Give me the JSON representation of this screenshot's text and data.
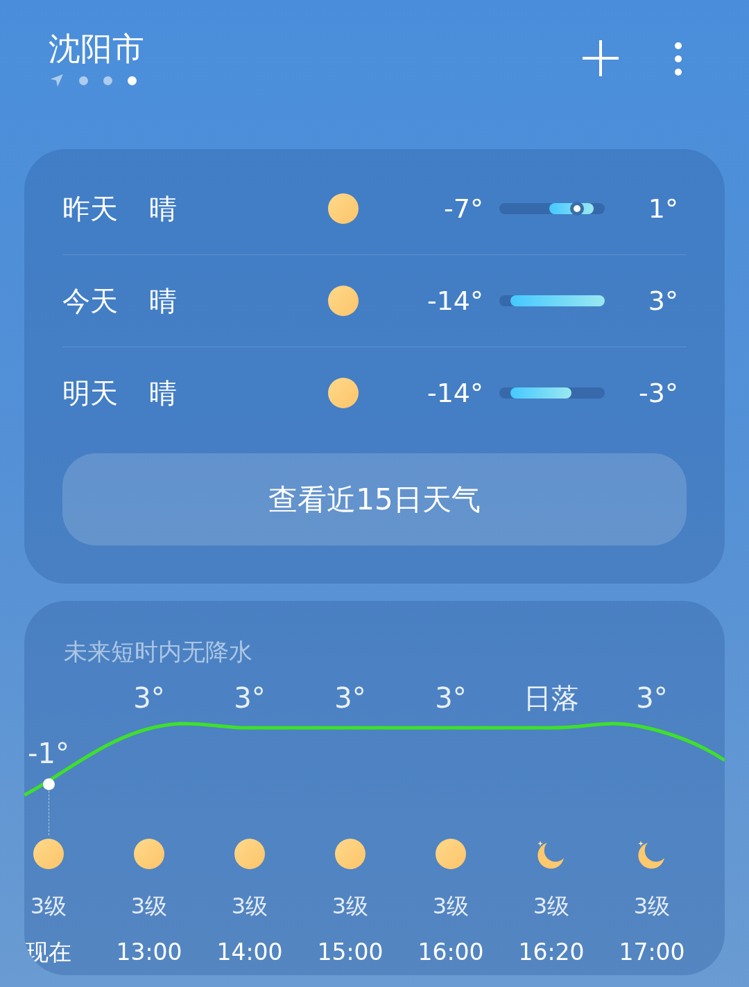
{
  "header": {
    "city": "沈阳市",
    "pages": [
      {
        "kind": "location",
        "selected": false
      },
      {
        "kind": "dot",
        "selected": false
      },
      {
        "kind": "dot",
        "selected": false
      },
      {
        "kind": "dot",
        "selected": true
      }
    ]
  },
  "forecast": {
    "days": [
      {
        "day": "昨天",
        "condition": "晴",
        "kind": "sun",
        "low": "-7°",
        "high": "1°",
        "current_marker": true
      },
      {
        "day": "今天",
        "condition": "晴",
        "kind": "sun",
        "low": "-14°",
        "high": "3°",
        "current_marker": false
      },
      {
        "day": "明天",
        "condition": "晴",
        "kind": "sun",
        "low": "-14°",
        "high": "-3°",
        "current_marker": false
      }
    ],
    "button": "查看近15日天气"
  },
  "hourly": {
    "title": "未来短时内无降水",
    "hours": [
      {
        "label": "-1°",
        "kind": "sun",
        "wind": "3级",
        "time": "现在",
        "current": true
      },
      {
        "label": "3°",
        "kind": "sun",
        "wind": "3级",
        "time": "13:00",
        "current": false
      },
      {
        "label": "3°",
        "kind": "sun",
        "wind": "3级",
        "time": "14:00",
        "current": false
      },
      {
        "label": "3°",
        "kind": "sun",
        "wind": "3级",
        "time": "15:00",
        "current": false
      },
      {
        "label": "3°",
        "kind": "sun",
        "wind": "3级",
        "time": "16:00",
        "current": false
      },
      {
        "label": "日落",
        "kind": "moon",
        "wind": "3级",
        "time": "16:20",
        "current": false
      },
      {
        "label": "3°",
        "kind": "moon",
        "wind": "3级",
        "time": "17:00",
        "current": false
      }
    ]
  }
}
